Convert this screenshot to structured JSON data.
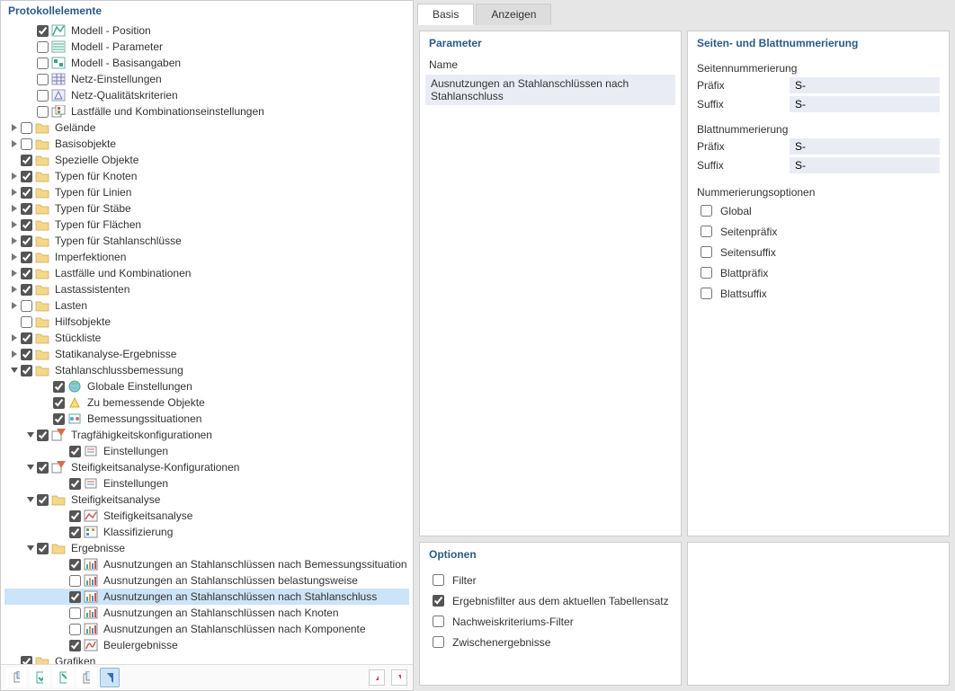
{
  "left": {
    "header": "Protokollelemente",
    "tree": [
      {
        "depth": 1,
        "exp": "",
        "checked": true,
        "icon": "model-pos",
        "label": "Modell - Position"
      },
      {
        "depth": 1,
        "exp": "",
        "checked": false,
        "icon": "model-param",
        "label": "Modell - Parameter"
      },
      {
        "depth": 1,
        "exp": "",
        "checked": false,
        "icon": "model-base",
        "label": "Modell - Basisangaben"
      },
      {
        "depth": 1,
        "exp": "",
        "checked": false,
        "icon": "mesh-settings",
        "label": "Netz-Einstellungen"
      },
      {
        "depth": 1,
        "exp": "",
        "checked": false,
        "icon": "mesh-quality",
        "label": "Netz-Qualitätskriterien"
      },
      {
        "depth": 1,
        "exp": "",
        "checked": false,
        "icon": "load-combos",
        "label": "Lastfälle und Kombinationseinstellungen"
      },
      {
        "depth": 0,
        "exp": ">",
        "checked": false,
        "icon": "folder",
        "label": "Gelände"
      },
      {
        "depth": 0,
        "exp": ">",
        "checked": false,
        "icon": "folder",
        "label": "Basisobjekte"
      },
      {
        "depth": 0,
        "exp": "",
        "checked": true,
        "icon": "folder",
        "label": "Spezielle Objekte"
      },
      {
        "depth": 0,
        "exp": ">",
        "checked": true,
        "icon": "folder",
        "label": "Typen für Knoten"
      },
      {
        "depth": 0,
        "exp": ">",
        "checked": true,
        "icon": "folder",
        "label": "Typen für Linien"
      },
      {
        "depth": 0,
        "exp": ">",
        "checked": true,
        "icon": "folder",
        "label": "Typen für Stäbe"
      },
      {
        "depth": 0,
        "exp": ">",
        "checked": true,
        "icon": "folder",
        "label": "Typen für Flächen"
      },
      {
        "depth": 0,
        "exp": ">",
        "checked": true,
        "icon": "folder",
        "label": "Typen für Stahlanschlüsse"
      },
      {
        "depth": 0,
        "exp": ">",
        "checked": true,
        "icon": "folder",
        "label": "Imperfektionen"
      },
      {
        "depth": 0,
        "exp": ">",
        "checked": true,
        "icon": "folder",
        "label": "Lastfälle und Kombinationen"
      },
      {
        "depth": 0,
        "exp": ">",
        "checked": true,
        "icon": "folder",
        "label": "Lastassistenten"
      },
      {
        "depth": 0,
        "exp": ">",
        "checked": false,
        "icon": "folder",
        "label": "Lasten"
      },
      {
        "depth": 0,
        "exp": "",
        "checked": false,
        "icon": "folder",
        "label": "Hilfsobjekte"
      },
      {
        "depth": 0,
        "exp": ">",
        "checked": true,
        "icon": "folder",
        "label": "Stückliste"
      },
      {
        "depth": 0,
        "exp": ">",
        "checked": true,
        "icon": "folder",
        "label": "Statikanalyse-Ergebnisse"
      },
      {
        "depth": 0,
        "exp": "v",
        "checked": true,
        "icon": "folder",
        "label": "Stahlanschlussbemessung"
      },
      {
        "depth": 2,
        "exp": "",
        "checked": true,
        "icon": "globe",
        "label": "Globale Einstellungen"
      },
      {
        "depth": 2,
        "exp": "",
        "checked": true,
        "icon": "objects",
        "label": "Zu bemessende Objekte"
      },
      {
        "depth": 2,
        "exp": "",
        "checked": true,
        "icon": "situations",
        "label": "Bemessungssituationen"
      },
      {
        "depth": 1,
        "exp": "v",
        "checked": true,
        "icon": "config",
        "label": "Tragfähigkeitskonfigurationen"
      },
      {
        "depth": 3,
        "exp": "",
        "checked": true,
        "icon": "settings",
        "label": "Einstellungen"
      },
      {
        "depth": 1,
        "exp": "v",
        "checked": true,
        "icon": "config",
        "label": "Steifigkeitsanalyse-Konfigurationen"
      },
      {
        "depth": 3,
        "exp": "",
        "checked": true,
        "icon": "settings",
        "label": "Einstellungen"
      },
      {
        "depth": 1,
        "exp": "v",
        "checked": true,
        "icon": "folder",
        "label": "Steifigkeitsanalyse"
      },
      {
        "depth": 3,
        "exp": "",
        "checked": true,
        "icon": "stiff-ana",
        "label": "Steifigkeitsanalyse"
      },
      {
        "depth": 3,
        "exp": "",
        "checked": true,
        "icon": "classify",
        "label": "Klassifizierung"
      },
      {
        "depth": 1,
        "exp": "v",
        "checked": true,
        "icon": "folder",
        "label": "Ergebnisse"
      },
      {
        "depth": 3,
        "exp": "",
        "checked": true,
        "icon": "result",
        "label": "Ausnutzungen an Stahlanschlüssen nach Bemessungssituation"
      },
      {
        "depth": 3,
        "exp": "",
        "checked": false,
        "icon": "result",
        "label": "Ausnutzungen an Stahlanschlüssen belastungsweise"
      },
      {
        "depth": 3,
        "exp": "",
        "checked": true,
        "icon": "result",
        "label": "Ausnutzungen an Stahlanschlüssen nach Stahlanschluss",
        "selected": true
      },
      {
        "depth": 3,
        "exp": "",
        "checked": false,
        "icon": "result",
        "label": "Ausnutzungen an Stahlanschlüssen nach Knoten"
      },
      {
        "depth": 3,
        "exp": "",
        "checked": false,
        "icon": "result",
        "label": "Ausnutzungen an Stahlanschlüssen nach Komponente"
      },
      {
        "depth": 3,
        "exp": "",
        "checked": true,
        "icon": "buckling",
        "label": "Beulergebnisse"
      },
      {
        "depth": 0,
        "exp": "",
        "checked": true,
        "icon": "folder",
        "label": "Grafiken"
      }
    ],
    "toolbar": {
      "btns": [
        "tree-tool-1",
        "tree-tool-2",
        "tree-tool-3",
        "tree-tool-4",
        "tree-tool-filter"
      ]
    }
  },
  "right": {
    "tabs": {
      "basis": "Basis",
      "anzeigen": "Anzeigen",
      "active": "basis"
    },
    "parameter": {
      "title": "Parameter",
      "name_label": "Name",
      "name_value": "Ausnutzungen an Stahlanschlüssen nach Stahlanschluss"
    },
    "numbering": {
      "title": "Seiten- und Blattnummerierung",
      "page_section": "Seitennummerierung",
      "sheet_section": "Blattnummerierung",
      "prefix_label": "Präfix",
      "suffix_label": "Suffix",
      "page_prefix": "S-",
      "page_suffix": "S-",
      "sheet_prefix": "S-",
      "sheet_suffix": "S-",
      "opts_title": "Nummerierungsoptionen",
      "opts": [
        {
          "label": "Global",
          "checked": false
        },
        {
          "label": "Seitenpräfix",
          "checked": false
        },
        {
          "label": "Seitensuffix",
          "checked": false
        },
        {
          "label": "Blattpräfix",
          "checked": false
        },
        {
          "label": "Blattsuffix",
          "checked": false
        }
      ]
    },
    "options": {
      "title": "Optionen",
      "items": [
        {
          "label": "Filter",
          "checked": false
        },
        {
          "label": "Ergebnisfilter aus dem aktuellen Tabellensatz",
          "checked": true
        },
        {
          "label": "Nachweiskriteriums-Filter",
          "checked": false
        },
        {
          "label": "Zwischenergebnisse",
          "checked": false
        }
      ]
    }
  }
}
